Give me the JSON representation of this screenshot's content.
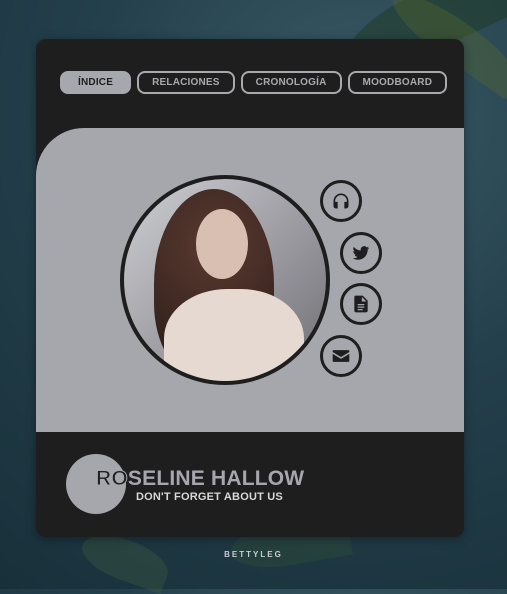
{
  "tabs": [
    {
      "label": "Índice",
      "active": true
    },
    {
      "label": "Relaciones",
      "active": false
    },
    {
      "label": "Cronología",
      "active": false
    },
    {
      "label": "Moodboard",
      "active": false
    }
  ],
  "profile": {
    "name_lead": "RO",
    "name_rest": "SELINE HALLOW",
    "tagline": "DON'T FORGET ABOUT US",
    "avatar": "portrait-photo"
  },
  "social_icons": [
    "headphones-icon",
    "twitter-icon",
    "document-icon",
    "envelope-icon"
  ],
  "footer": {
    "credit": "BETTYLEG"
  },
  "colors": {
    "card": "#1e1e1f",
    "panel": "#a6a7ad",
    "text_light": "#d8d8dc"
  }
}
